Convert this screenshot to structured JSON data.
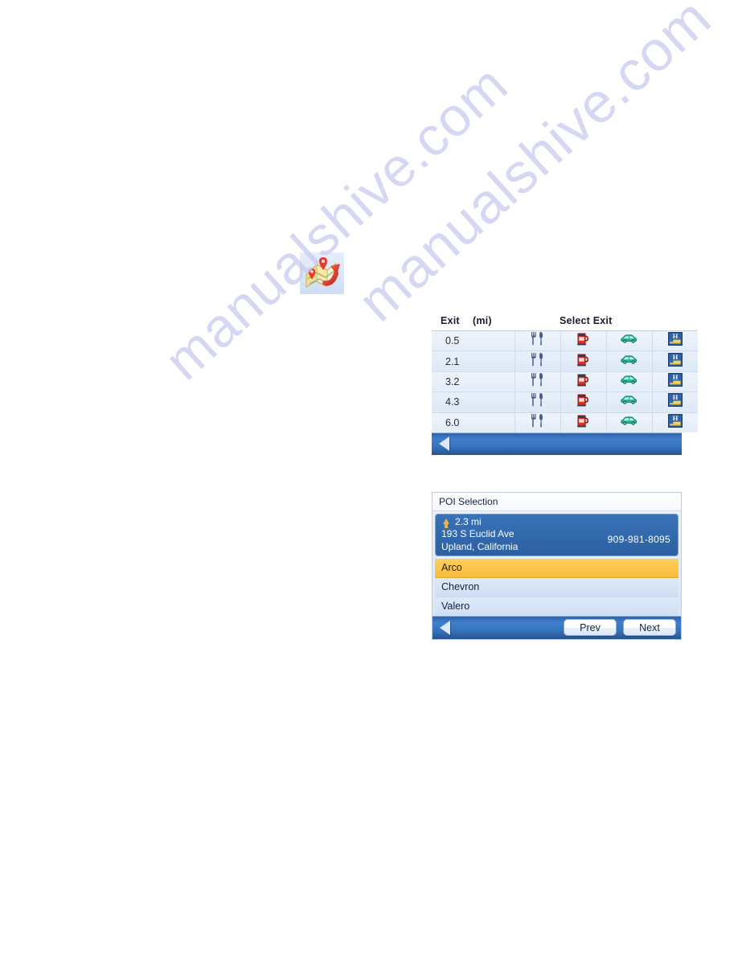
{
  "watermark": {
    "line1": "manualshive.com",
    "line2": "manualshive.com"
  },
  "map_icon": {
    "name": "map-with-pins-icon"
  },
  "exit_screen": {
    "header": {
      "exit_label": "Exit",
      "unit_label": "(mi)",
      "title": "Select Exit"
    },
    "columns": [
      "distance",
      "restaurant",
      "gas",
      "auto",
      "hotel"
    ],
    "rows": [
      {
        "distance": "0.5"
      },
      {
        "distance": "2.1"
      },
      {
        "distance": "3.2"
      },
      {
        "distance": "4.3"
      },
      {
        "distance": "6.0"
      }
    ],
    "icons": {
      "restaurant": "restaurant-icon",
      "gas": "gas-station-icon",
      "auto": "auto-service-icon",
      "hotel": "hotel-icon"
    },
    "nav": {
      "back": "back-arrow-icon"
    }
  },
  "poi_screen": {
    "title": "POI Selection",
    "detail": {
      "distance": "2.3 mi",
      "address_line1": "193 S Euclid Ave",
      "address_line2": "Upland, California",
      "phone": "909-981-8095",
      "direction_icon": "arrow-up-icon"
    },
    "items": [
      {
        "label": "Arco",
        "selected": true
      },
      {
        "label": "Chevron",
        "selected": false
      },
      {
        "label": "Valero",
        "selected": false
      }
    ],
    "buttons": {
      "prev": "Prev",
      "next": "Next",
      "back": "back-arrow-icon"
    }
  },
  "colors": {
    "accent_blue": "#3269ac",
    "selected_amber": "#f9bd3c",
    "nav_bar": "#3673bd",
    "gas_red": "#e03127",
    "car_green": "#19b89a",
    "hotel_blue": "#2f62ad",
    "watermark": "#c9cbef"
  }
}
